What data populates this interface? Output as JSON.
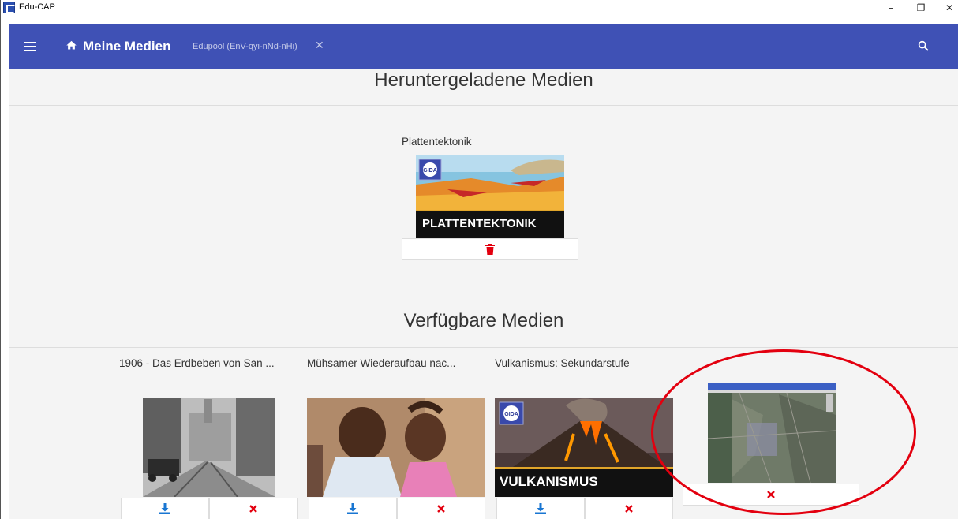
{
  "window": {
    "title": "Edu-CAP",
    "minimize": "–",
    "restore": "❐",
    "close": "✕"
  },
  "appbar": {
    "title": "Meine Medien",
    "subtitle": "Edupool (EnV-qyi-nNd-nHi)",
    "chip_close": "✕"
  },
  "downloaded": {
    "heading": "Heruntergeladene Medien",
    "items": [
      {
        "title": "Plattentektonik",
        "banner": "PLATTENTEKTONIK",
        "logo": "GIDA"
      }
    ]
  },
  "available": {
    "heading": "Verfügbare Medien",
    "items": [
      {
        "title": "1906 - Das Erdbeben von San ..."
      },
      {
        "title": "Mühsamer Wiederaufbau nac..."
      },
      {
        "title": "Vulkanismus: Sekundarstufe",
        "banner": "VULKANISMUS",
        "logo": "GIDA"
      },
      {
        "title": ""
      }
    ]
  },
  "colors": {
    "appbar": "#3f51b5",
    "delete": "#e3000f",
    "download": "#1976d2",
    "highlight": "#e3000f"
  },
  "icons": [
    "menu-icon",
    "home-icon",
    "search-icon",
    "trash-icon",
    "download-icon",
    "remove-icon"
  ]
}
